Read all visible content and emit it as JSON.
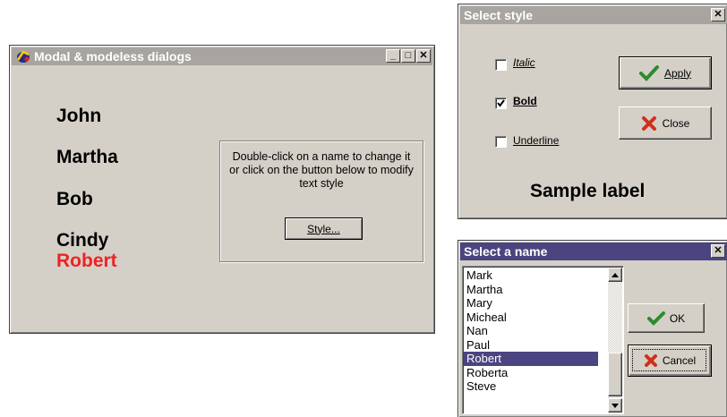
{
  "main_window": {
    "title": "Modal & modeless dialogs",
    "controls": [
      "_",
      "□",
      "✕"
    ],
    "names": [
      "John",
      "Martha",
      "Bob",
      "Cindy",
      "Robert"
    ],
    "highlight_color": "#ee2222",
    "help_text": "Double-click on a name to change it or click on the button below to modify text style",
    "style_button": "Style..."
  },
  "style_dialog": {
    "title": "Select style",
    "close": "✕",
    "options": [
      {
        "label": "Italic",
        "checked": false
      },
      {
        "label": "Bold",
        "checked": true
      },
      {
        "label": "Underline",
        "checked": false
      }
    ],
    "apply_button": "Apply",
    "close_button": "Close",
    "sample_label": "Sample label"
  },
  "name_dialog": {
    "title": "Select a name",
    "close": "✕",
    "items": [
      "Mark",
      "Martha",
      "Mary",
      "Micheal",
      "Nan",
      "Paul",
      "Robert",
      "Roberta",
      "Steve"
    ],
    "selected": "Robert",
    "ok_button": "OK",
    "cancel_button": "Cancel"
  },
  "colors": {
    "active_title": "#4a4580",
    "inactive_title": "#a8a4a0",
    "face": "#d4d0c8",
    "check_green": "#2e8b2e",
    "cross_red": "#d0301a"
  }
}
